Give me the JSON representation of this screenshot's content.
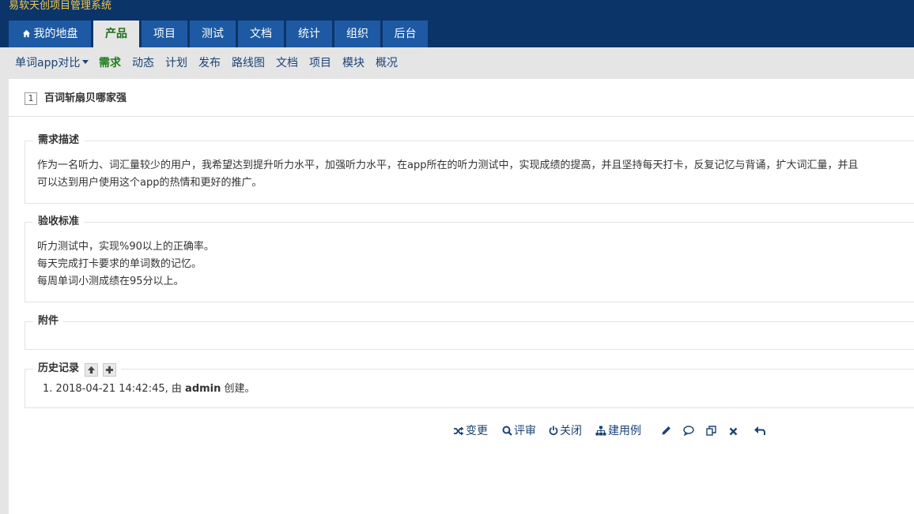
{
  "app": {
    "title": "易软天创项目管理系统"
  },
  "main_nav": {
    "tabs": [
      {
        "label": "我的地盘",
        "icon": "home-icon"
      },
      {
        "label": "产品",
        "active": true
      },
      {
        "label": "项目"
      },
      {
        "label": "测试"
      },
      {
        "label": "文档"
      },
      {
        "label": "统计"
      },
      {
        "label": "组织"
      },
      {
        "label": "后台"
      }
    ]
  },
  "sub_nav": {
    "product_selector": "单词app对比",
    "items": [
      {
        "label": "需求",
        "active": true
      },
      {
        "label": "动态"
      },
      {
        "label": "计划"
      },
      {
        "label": "发布"
      },
      {
        "label": "路线图"
      },
      {
        "label": "文档"
      },
      {
        "label": "项目"
      },
      {
        "label": "模块"
      },
      {
        "label": "概况"
      }
    ]
  },
  "story": {
    "id": "1",
    "title": "百词斩扇贝哪家强",
    "sections": {
      "description": {
        "title": "需求描述",
        "lines": [
          "作为一名听力、词汇量较少的用户，我希望达到提升听力水平，加强听力水平，在app所在的听力测试中，实现成绩的提高，并且坚持每天打卡，反复记忆与背诵，扩大词汇量，并且",
          "可以达到用户使用这个app的热情和更好的推广。"
        ]
      },
      "acceptance": {
        "title": "验收标准",
        "lines": [
          "听力测试中，实现%90以上的正确率。",
          "每天完成打卡要求的单词数的记忆。",
          "每周单词小测成绩在95分以上。"
        ]
      },
      "attachments": {
        "title": "附件"
      },
      "history": {
        "title": "历史记录",
        "items": [
          {
            "index": "1.",
            "time": "2018-04-21 14:42:45,",
            "by": "由",
            "user": "admin",
            "action": "创建。"
          }
        ]
      }
    }
  },
  "actions": {
    "change": "变更",
    "review": "评审",
    "close": "关闭",
    "create_case": "建用例"
  },
  "colors": {
    "header_bg": "#0b3568",
    "tab_bg": "#1d5aa3",
    "active_green": "#1e7e1e",
    "link_blue": "#1a4377",
    "brand_yellow": "#f7c94b"
  }
}
